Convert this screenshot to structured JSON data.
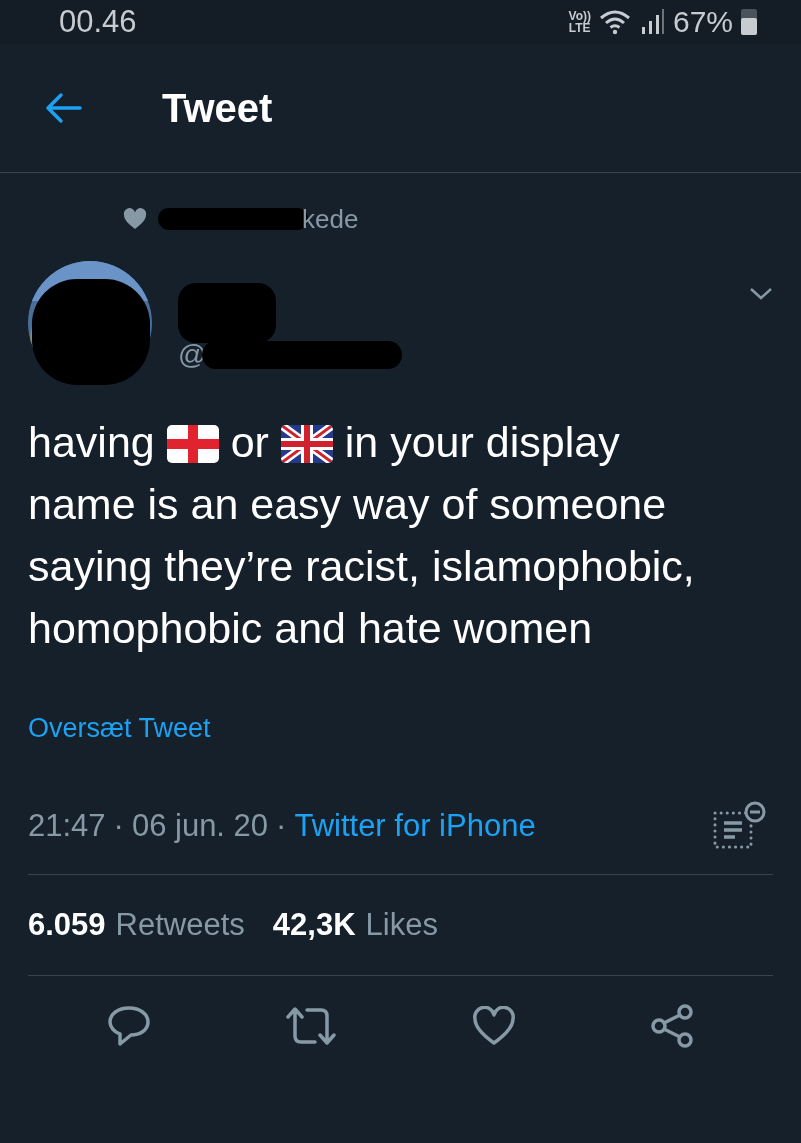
{
  "status_bar": {
    "time": "00.46",
    "network": "Vo))\nLTE",
    "battery": "67%"
  },
  "header": {
    "title": "Tweet"
  },
  "social_context": {
    "text": "kede"
  },
  "author": {
    "handle": "@"
  },
  "tweet": {
    "parts": [
      {
        "kind": "text",
        "text": "having"
      },
      {
        "kind": "cross_flag"
      },
      {
        "kind": "text",
        "text": "or"
      },
      {
        "kind": "union_flag"
      },
      {
        "kind": "text",
        "text": "in your display"
      },
      {
        "kind": "text_block",
        "text": "name is an easy way of someone saying they’re racist, islamophobic, homophobic and hate women"
      }
    ]
  },
  "translate_link": "Oversæt Tweet",
  "meta": {
    "time": "21:47",
    "separator": "·",
    "date": "06 jun. 20",
    "source": "Twitter for iPhone"
  },
  "stats": [
    {
      "count": "6.059",
      "label": "Retweets"
    },
    {
      "count": "42,3K",
      "label": "Likes"
    }
  ]
}
